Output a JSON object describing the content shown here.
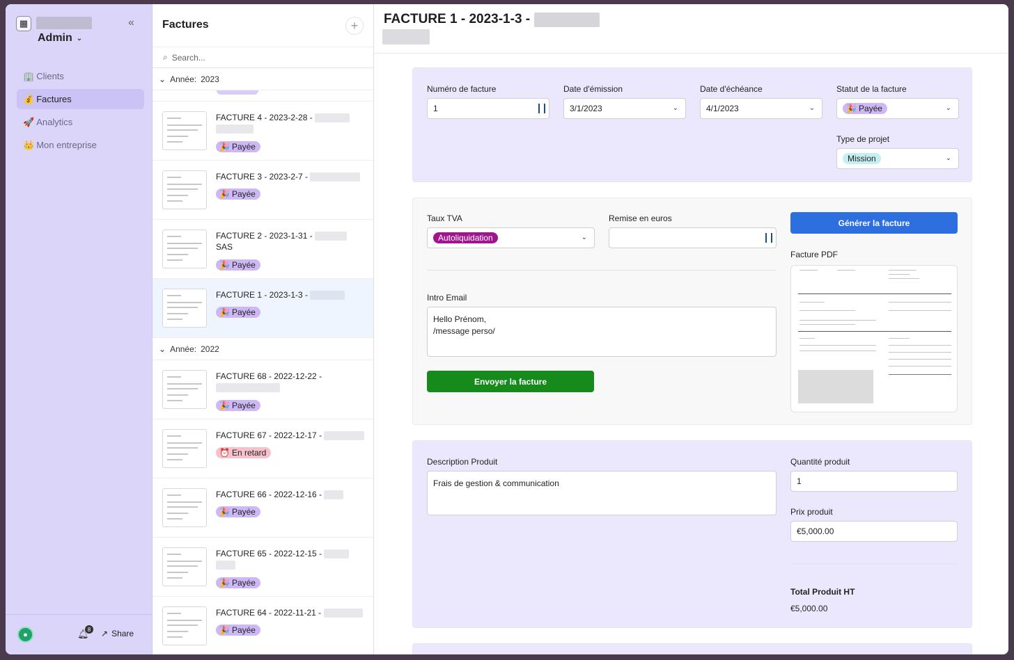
{
  "sidebar": {
    "workspace_icon": "calculator-icon",
    "role": "Admin",
    "items": [
      {
        "icon": "🏢",
        "label": "Clients"
      },
      {
        "icon": "💰",
        "label": "Factures"
      },
      {
        "icon": "🚀",
        "label": "Analytics"
      },
      {
        "icon": "👑",
        "label": "Mon entreprise"
      }
    ],
    "notifications": "8",
    "share": "Share"
  },
  "list": {
    "title": "Factures",
    "search_placeholder": "Search...",
    "groups": [
      {
        "label": "Année:",
        "year": "2023"
      },
      {
        "label": "Année:",
        "year": "2022"
      }
    ],
    "invoices_2023": [
      {
        "title": "FACTURE 4 - 2023-2-28 -",
        "status": "Payée",
        "emoji": "🎉"
      },
      {
        "title": "FACTURE 3 - 2023-2-7 -",
        "status": "Payée",
        "emoji": "🎉"
      },
      {
        "title": "FACTURE 2 - 2023-1-31 -",
        "extra": "SAS",
        "status": "Payée",
        "emoji": "🎉"
      },
      {
        "title": "FACTURE 1 - 2023-1-3 -",
        "status": "Payée",
        "emoji": "🎉"
      }
    ],
    "invoices_2022": [
      {
        "title": "FACTURE 68 - 2022-12-22 -",
        "status": "Payée",
        "emoji": "🎉"
      },
      {
        "title": "FACTURE 67 - 2022-12-17 -",
        "status": "En retard",
        "emoji": "⏰"
      },
      {
        "title": "FACTURE 66 - 2022-12-16 -",
        "status": "Payée",
        "emoji": "🎉"
      },
      {
        "title": "FACTURE 65 - 2022-12-15 -",
        "status": "Payée",
        "emoji": "🎉"
      },
      {
        "title": "FACTURE 64 - 2022-11-21 -",
        "status": "Payée",
        "emoji": "🎉"
      }
    ]
  },
  "main": {
    "title": "FACTURE 1 - 2023-1-3 -",
    "section1": {
      "numero_label": "Numéro de facture",
      "numero_value": "1",
      "emission_label": "Date d'émission",
      "emission_value": "3/1/2023",
      "echeance_label": "Date d'échéance",
      "echeance_value": "4/1/2023",
      "statut_label": "Statut de la facture",
      "statut_value": "Payée",
      "statut_emoji": "🎉",
      "type_label": "Type de projet",
      "type_value": "Mission"
    },
    "section2": {
      "tva_label": "Taux TVA",
      "tva_value": "Autoliquidation",
      "remise_label": "Remise en euros",
      "remise_value": "",
      "generate_button": "Générer la facture",
      "pdf_label": "Facture PDF",
      "intro_label": "Intro Email",
      "intro_line1": "Hello Prénom,",
      "intro_line2": "/message perso/",
      "send_button": "Envoyer la facture"
    },
    "section3": {
      "desc_label": "Description Produit",
      "desc_value": "Frais de gestion & communication",
      "qty_label": "Quantité produit",
      "qty_value": "1",
      "price_label": "Prix produit",
      "price_value": "€5,000.00",
      "total_label": "Total Produit HT",
      "total_value": "€5,000.00"
    }
  },
  "colors": {
    "sidebar_bg": "#dcd5fa",
    "card_bg": "#ebe8fd",
    "primary_button": "#2e6fe0",
    "send_button": "#168a1a",
    "status_paid": "#cdb8f5",
    "status_late": "#f7c1cb",
    "tva_pill": "#a0148e",
    "type_pill": "#c5eef0"
  }
}
